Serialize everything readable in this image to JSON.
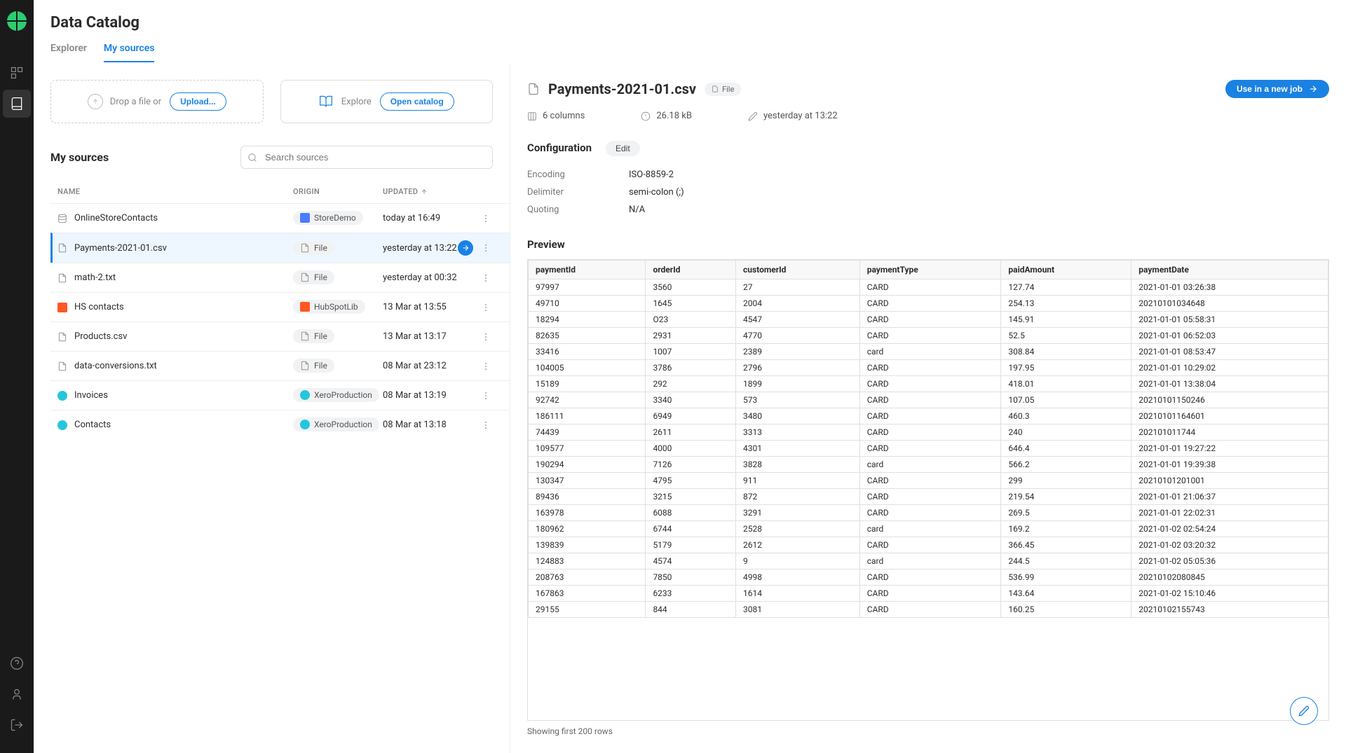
{
  "header": {
    "title": "Data Catalog",
    "tabs": [
      {
        "label": "Explorer",
        "active": false
      },
      {
        "label": "My sources",
        "active": true
      }
    ]
  },
  "upload": {
    "drop_text": "Drop a file or",
    "upload_label": "Upload...",
    "explore_text": "Explore",
    "open_catalog_label": "Open catalog"
  },
  "sources": {
    "title": "My sources",
    "search_placeholder": "Search sources",
    "columns": {
      "name": "NAME",
      "origin": "ORIGIN",
      "updated": "UPDATED"
    },
    "rows": [
      {
        "icon": "db",
        "name": "OnlineStoreContacts",
        "origin_icon": "blue",
        "origin": "StoreDemo",
        "updated": "today at 16:49",
        "selected": false
      },
      {
        "icon": "file",
        "name": "Payments-2021-01.csv",
        "origin_icon": "file",
        "origin": "File",
        "updated": "yesterday at 13:22",
        "selected": true
      },
      {
        "icon": "file",
        "name": "math-2.txt",
        "origin_icon": "file",
        "origin": "File",
        "updated": "yesterday at 00:32",
        "selected": false
      },
      {
        "icon": "orange",
        "name": "HS contacts",
        "origin_icon": "orange",
        "origin": "HubSpotLib",
        "updated": "13 Mar at 13:55",
        "selected": false
      },
      {
        "icon": "file",
        "name": "Products.csv",
        "origin_icon": "file",
        "origin": "File",
        "updated": "13 Mar at 13:17",
        "selected": false
      },
      {
        "icon": "file",
        "name": "data-conversions.txt",
        "origin_icon": "file",
        "origin": "File",
        "updated": "08 Mar at 23:12",
        "selected": false
      },
      {
        "icon": "teal",
        "name": "Invoices",
        "origin_icon": "teal",
        "origin": "XeroProduction",
        "updated": "08 Mar at 13:19",
        "selected": false
      },
      {
        "icon": "teal",
        "name": "Contacts",
        "origin_icon": "teal",
        "origin": "XeroProduction",
        "updated": "08 Mar at 13:18",
        "selected": false
      }
    ]
  },
  "detail": {
    "name": "Payments-2021-01.csv",
    "tag": "File",
    "use_btn": "Use in a new job",
    "meta": {
      "columns": "6 columns",
      "size": "26.18 kB",
      "modified": "yesterday at 13:22"
    },
    "config": {
      "title": "Configuration",
      "edit": "Edit",
      "rows": [
        {
          "label": "Encoding",
          "value": "ISO-8859-2"
        },
        {
          "label": "Delimiter",
          "value": "semi-colon (;)"
        },
        {
          "label": "Quoting",
          "value": "N/A"
        }
      ]
    },
    "preview": {
      "title": "Preview",
      "footer": "Showing first 200 rows",
      "headers": [
        "paymentId",
        "orderId",
        "customerId",
        "paymentType",
        "paidAmount",
        "paymentDate"
      ],
      "rows": [
        [
          "97997",
          "3560",
          "27",
          "CARD",
          "127.74",
          "2021-01-01 03:26:38"
        ],
        [
          "49710",
          "1645",
          "2004",
          "CARD",
          "254.13",
          "20210101034648"
        ],
        [
          "18294",
          "O23",
          "4547",
          "CARD",
          "145.91",
          "2021-01-01 05:58:31"
        ],
        [
          "82635",
          "2931",
          "4770",
          "CARD",
          "52.5",
          "2021-01-01 06:52:03"
        ],
        [
          "33416",
          "1007",
          "2389",
          "card",
          "308.84",
          "2021-01-01 08:53:47"
        ],
        [
          "104005",
          "3786",
          "2796",
          "CARD",
          "197.95",
          "2021-01-01 10:29:02"
        ],
        [
          "15189",
          "292",
          "1899",
          "CARD",
          "418.01",
          "2021-01-01 13:38:04"
        ],
        [
          "92742",
          "3340",
          "573",
          "CARD",
          "107.05",
          "20210101150246"
        ],
        [
          "186111",
          "6949",
          "3480",
          "CARD",
          "460.3",
          "20210101164601"
        ],
        [
          "74439",
          "2611",
          "3313",
          "CARD",
          "240",
          "202101011744"
        ],
        [
          "109577",
          "4000",
          "4301",
          "CARD",
          "646.4",
          "2021-01-01 19:27:22"
        ],
        [
          "190294",
          "7126",
          "3828",
          "card",
          "566.2",
          "2021-01-01 19:39:38"
        ],
        [
          "130347",
          "4795",
          "911",
          "CARD",
          "299",
          "20210101201001"
        ],
        [
          "89436",
          "3215",
          "872",
          "CARD",
          "219.54",
          "2021-01-01 21:06:37"
        ],
        [
          "163978",
          "6088",
          "3291",
          "CARD",
          "269.5",
          "2021-01-01 22:02:31"
        ],
        [
          "180962",
          "6744",
          "2528",
          "card",
          "169.2",
          "2021-01-02 02:54:24"
        ],
        [
          "139839",
          "5179",
          "2612",
          "CARD",
          "366.45",
          "2021-01-02 03:20:32"
        ],
        [
          "124883",
          "4574",
          "9",
          "card",
          "244.5",
          "2021-01-02 05:05:36"
        ],
        [
          "208763",
          "7850",
          "4998",
          "CARD",
          "536.99",
          "20210102080845"
        ],
        [
          "167863",
          "6233",
          "1614",
          "CARD",
          "143.64",
          "2021-01-02 15:10:46"
        ],
        [
          "29155",
          "844",
          "3081",
          "CARD",
          "160.25",
          "20210102155743"
        ]
      ]
    }
  }
}
